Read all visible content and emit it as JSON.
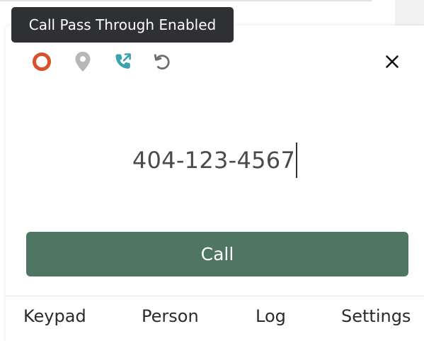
{
  "tooltip": {
    "text": "Call Pass Through Enabled"
  },
  "status_icons": [
    {
      "name": "record-icon",
      "color": "#d9512c"
    },
    {
      "name": "location-pin-icon",
      "color": "#b7b7b7"
    },
    {
      "name": "call-pass-through-icon",
      "color": "#3aa3b0"
    },
    {
      "name": "undo-icon",
      "color": "#6d6d6d"
    }
  ],
  "close": {
    "icon": "close-icon"
  },
  "dialer": {
    "number": "404-123-4567",
    "call_label": "Call",
    "call_color": "#4f7563"
  },
  "nav": {
    "tabs": [
      {
        "label": "Keypad"
      },
      {
        "label": "Person"
      },
      {
        "label": "Log"
      },
      {
        "label": "Settings"
      }
    ]
  }
}
